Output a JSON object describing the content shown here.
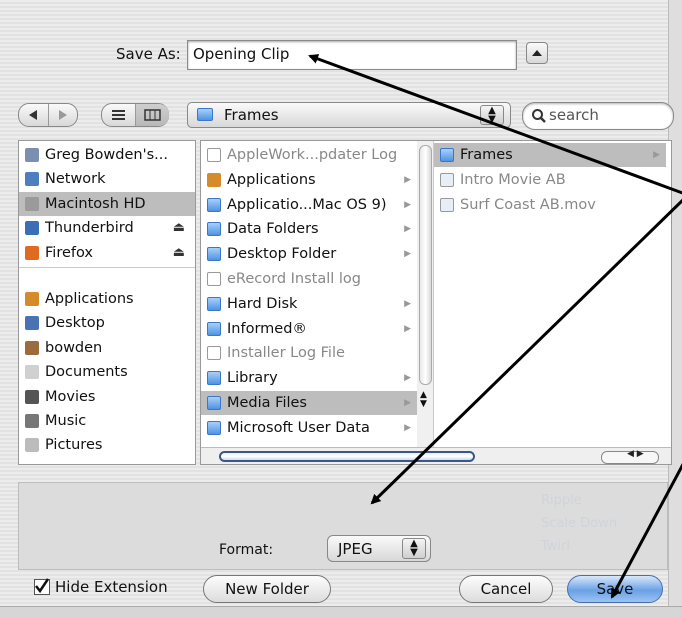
{
  "save_as": {
    "label": "Save As:",
    "value": "Opening Clip"
  },
  "toolbar": {
    "location": "Frames",
    "search_placeholder": "search"
  },
  "sidebar": {
    "devices": [
      {
        "label": "Greg Bowden's...",
        "icon": "imac-icon"
      },
      {
        "label": "Network",
        "icon": "network-globe-icon"
      },
      {
        "label": "Macintosh HD",
        "icon": "hard-drive-icon",
        "selected": true
      },
      {
        "label": "Thunderbird",
        "icon": "thunderbird-icon",
        "eject": "⏏"
      },
      {
        "label": "Firefox",
        "icon": "firefox-icon",
        "eject": "⏏"
      }
    ],
    "places": [
      {
        "label": "Applications",
        "icon": "applications-icon"
      },
      {
        "label": "Desktop",
        "icon": "desktop-icon"
      },
      {
        "label": "bowden",
        "icon": "home-icon"
      },
      {
        "label": "Documents",
        "icon": "documents-icon"
      },
      {
        "label": "Movies",
        "icon": "movies-icon"
      },
      {
        "label": "Music",
        "icon": "music-icon"
      },
      {
        "label": "Pictures",
        "icon": "pictures-icon"
      }
    ]
  },
  "column1": [
    {
      "label": "AppleWork...pdater Log",
      "type": "doc",
      "dim": true
    },
    {
      "label": "Applications",
      "type": "app",
      "arrow": true
    },
    {
      "label": "Applicatio...Mac OS 9)",
      "type": "folder",
      "arrow": true
    },
    {
      "label": "Data Folders",
      "type": "folder",
      "arrow": true
    },
    {
      "label": "Desktop Folder",
      "type": "folder",
      "arrow": true
    },
    {
      "label": "eRecord Install log",
      "type": "doc",
      "dim": true
    },
    {
      "label": "Hard Disk",
      "type": "folder",
      "arrow": true
    },
    {
      "label": "Informed®",
      "type": "folder",
      "arrow": true
    },
    {
      "label": "Installer Log File",
      "type": "doc",
      "dim": true
    },
    {
      "label": "Library",
      "type": "folder",
      "arrow": true
    },
    {
      "label": "Media Files",
      "type": "folder",
      "arrow": true,
      "selected": true
    },
    {
      "label": "Microsoft User Data",
      "type": "folder",
      "arrow": true
    }
  ],
  "column2": [
    {
      "label": "Frames",
      "type": "folder",
      "arrow": true,
      "selected": true
    },
    {
      "label": "Intro Movie AB",
      "type": "movie",
      "dim": true
    },
    {
      "label": "Surf Coast AB.mov",
      "type": "movie",
      "dim": true
    }
  ],
  "format": {
    "label": "Format:",
    "value": "JPEG"
  },
  "footer": {
    "hide_extension": "Hide Extension",
    "hide_extension_checked": true,
    "new_folder": "New Folder",
    "cancel": "Cancel",
    "save": "Save"
  },
  "background_ghost": {
    "texts": [
      "Ripple",
      "Scale Down",
      "Twirl"
    ]
  },
  "colors": {
    "selection": "#bdbdbd",
    "default_button": "#6aa1e6",
    "folder": "#4f93e3"
  }
}
